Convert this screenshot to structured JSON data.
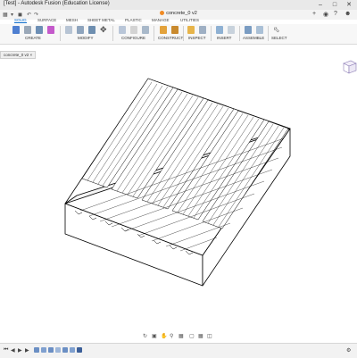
{
  "window": {
    "title": "[Test] - Autodesk Fusion (Education License)"
  },
  "document": {
    "title": "concrete_0 v2"
  },
  "tabs": [
    "SOLID",
    "SURFACE",
    "MESH",
    "SHEET METAL",
    "PLASTIC",
    "MANAGE",
    "UTILITIES"
  ],
  "active_tab": "SOLID",
  "ribbon_groups": [
    "CREATE",
    "MODIFY",
    "CONFIGURE",
    "CONSTRUCT",
    "INSPECT",
    "INSERT",
    "ASSEMBLE",
    "SELECT"
  ],
  "browser": {
    "tab_label": "concrete_0 v2"
  },
  "colors": {
    "accent": "#0b6ccb",
    "doc_dot": "#f08a24"
  },
  "icons": {
    "minimize": "minimize-icon",
    "maximize": "maximize-icon",
    "close": "close-icon"
  }
}
